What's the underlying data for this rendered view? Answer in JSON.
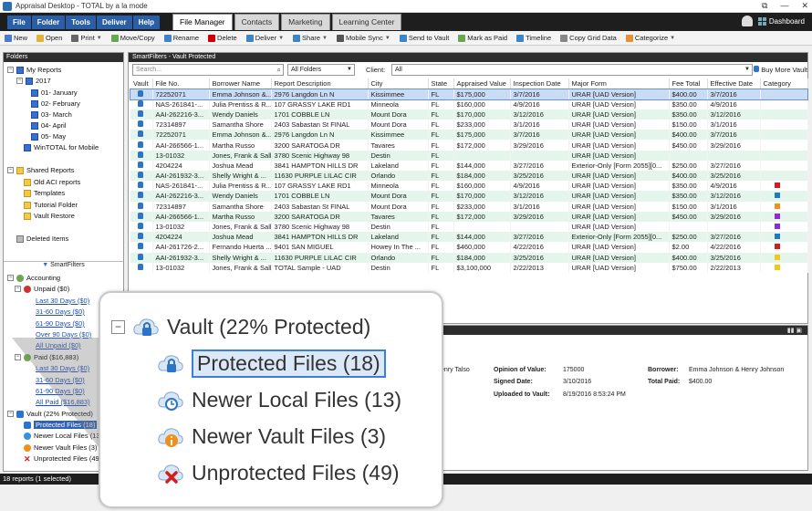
{
  "window": {
    "title": "Appraisal Desktop - TOTAL by a la mode",
    "controls": [
      "⧉",
      "—",
      "✕"
    ]
  },
  "menubar": {
    "menus": [
      "File",
      "Folder",
      "Tools",
      "Deliver",
      "Help"
    ],
    "tabs": [
      "File Manager",
      "Contacts",
      "Marketing",
      "Learning Center"
    ],
    "dashboard_label": "Dashboard"
  },
  "toolbar": {
    "items": [
      {
        "label": "New",
        "icon": "new-icon",
        "color": "#4a7bd0"
      },
      {
        "label": "Open",
        "icon": "open-icon",
        "color": "#e0b43c"
      },
      {
        "label": "Print",
        "icon": "print-icon",
        "color": "#666666",
        "caret": true
      },
      {
        "label": "Move/Copy",
        "icon": "move-copy-icon",
        "color": "#6aa84f"
      },
      {
        "label": "Rename",
        "icon": "rename-icon",
        "color": "#3d85c6"
      },
      {
        "label": "Delete",
        "icon": "delete-icon",
        "color": "#cc0000"
      },
      {
        "label": "Deliver",
        "icon": "deliver-icon",
        "color": "#3d85c6",
        "caret": true
      },
      {
        "label": "Share",
        "icon": "share-icon",
        "color": "#3d85c6",
        "caret": true
      },
      {
        "label": "Mobile Sync",
        "icon": "mobile-sync-icon",
        "color": "#555555",
        "caret": true
      },
      {
        "label": "Send to Vault",
        "icon": "send-vault-icon",
        "color": "#3d85c6"
      },
      {
        "label": "Mark as Paid",
        "icon": "mark-paid-icon",
        "color": "#6aa84f"
      },
      {
        "label": "Timeline",
        "icon": "timeline-icon",
        "color": "#3d85c6"
      },
      {
        "label": "Copy Grid Data",
        "icon": "copy-grid-icon",
        "color": "#888888"
      },
      {
        "label": "Categorize",
        "icon": "categorize-icon",
        "color": "#e69138",
        "caret": true
      }
    ]
  },
  "folders": {
    "header": "Folders",
    "my_reports": "My Reports",
    "year": "2017",
    "months": [
      "01- January",
      "02- February",
      "03- March",
      "04- April",
      "05- May"
    ],
    "wintotal": "WinTOTAL for Mobile",
    "shared_reports": "Shared Reports",
    "shared_items": [
      "Old ACI reports",
      "Templates",
      "Tutorial Folder",
      "Vault Restore"
    ],
    "deleted_items": "Deleted Items",
    "smartfilters_label": "SmartFilters",
    "accounting": "Accounting",
    "unpaid": "Unpaid ($0)",
    "unpaid_items": [
      "Last 30 Days ($0)",
      "31-60 Days ($0)",
      "61-90 Days ($0)",
      "Over 90 Days ($0)",
      "All Unpaid ($0)"
    ],
    "paid": "Paid ($16,883)",
    "paid_items": [
      "Last 30 Days ($0)",
      "31-60 Days ($0)",
      "61-90 Days ($0)",
      "All Paid ($16,883)"
    ],
    "vault": "Vault (22% Protected)",
    "vault_items": [
      "Protected Files (18)",
      "Newer Local Files (13)",
      "Newer Vault Files (3)",
      "Unprotected Files (49)"
    ]
  },
  "main": {
    "header": "SmartFilters - Vault Protected",
    "search_placeholder": "Search...",
    "folder_filter": "All Folders",
    "client_label": "Client:",
    "client_filter": "All",
    "buy_more": "Buy More Vault",
    "columns": [
      "Vault",
      "File No.",
      "Borrower Name",
      "Report Description",
      "City",
      "State",
      "Appraised Value",
      "Inspection Date",
      "Major Form",
      "Fee Total",
      "Effective Date",
      "Category"
    ],
    "rows": [
      [
        "72252071",
        "Emma Johnson &...",
        "2976 Langdon Ln N",
        "Kissimmee",
        "FL",
        "$175,000",
        "3/7/2016",
        "URAR [UAD Version]",
        "$400.00",
        "3/7/2016",
        ""
      ],
      [
        "NAS-261841-...",
        "Julia Prentiss & R...",
        "107 GRASSY LAKE RD1",
        "Minneola",
        "FL",
        "$160,000",
        "4/9/2016",
        "URAR [UAD Version]",
        "$350.00",
        "4/9/2016",
        ""
      ],
      [
        "AAI-262216-3...",
        "Wendy Daniels",
        "1701 COBBLE LN",
        "Mount Dora",
        "FL",
        "$170,000",
        "3/12/2016",
        "URAR [UAD Version]",
        "$350.00",
        "3/12/2016",
        ""
      ],
      [
        "72314897",
        "Samantha Shore",
        "2403 Sabastan St FINAL",
        "Mount Dora",
        "FL",
        "$233,000",
        "3/1/2016",
        "URAR [UAD Version]",
        "$150.00",
        "3/1/2016",
        ""
      ],
      [
        "72252071",
        "Emma Johnson &...",
        "2976 Langdon Ln N",
        "Kissimmee",
        "FL",
        "$175,000",
        "3/7/2016",
        "URAR [UAD Version]",
        "$400.00",
        "3/7/2016",
        ""
      ],
      [
        "AAI-266566-1...",
        "Martha Russo",
        "3200 SARATOGA DR",
        "Tavares",
        "FL",
        "$172,000",
        "3/29/2016",
        "URAR [UAD Version]",
        "$450.00",
        "3/29/2016",
        ""
      ],
      [
        "13-01032",
        "Jones, Frank & Sally",
        "3780 Scenic Highway 98",
        "Destin",
        "FL",
        "",
        "",
        "URAR [UAD Version]",
        "",
        "",
        ""
      ],
      [
        "4204224",
        "Joshua Mead",
        "3841 HAMPTON HILLS DR",
        "Lakeland",
        "FL",
        "$144,000",
        "3/27/2016",
        "Exterior-Only [Form 2055][0...",
        "$250.00",
        "3/27/2016",
        ""
      ],
      [
        "AAI-261932-3...",
        "Shelly Wright & ...",
        "11630 PURPLE LILAC CIR",
        "Orlando",
        "FL",
        "$184,000",
        "3/25/2016",
        "URAR [UAD Version]",
        "$400.00",
        "3/25/2016",
        ""
      ],
      [
        "NAS-261841-...",
        "Julia Prentiss & R...",
        "107 GRASSY LAKE RD1",
        "Minneola",
        "FL",
        "$160,000",
        "4/9/2016",
        "URAR [UAD Version]",
        "$350.00",
        "4/9/2016",
        "red"
      ],
      [
        "AAI-262216-3...",
        "Wendy Daniels",
        "1701 COBBLE LN",
        "Mount Dora",
        "FL",
        "$170,000",
        "3/12/2016",
        "URAR [UAD Version]",
        "$350.00",
        "3/12/2016",
        "blue"
      ],
      [
        "72314897",
        "Samantha Shore",
        "2403 Sabastan St FINAL",
        "Mount Dora",
        "FL",
        "$233,000",
        "3/1/2016",
        "URAR [UAD Version]",
        "$150.00",
        "3/1/2016",
        "orange"
      ],
      [
        "AAI-266566-1...",
        "Martha Russo",
        "3200 SARATOGA DR",
        "Tavares",
        "FL",
        "$172,000",
        "3/29/2016",
        "URAR [UAD Version]",
        "$450.00",
        "3/29/2016",
        "purple"
      ],
      [
        "13-01032",
        "Jones, Frank & Sally",
        "3780 Scenic Highway 98",
        "Destin",
        "FL",
        "",
        "",
        "URAR [UAD Version]",
        "",
        "",
        "purple"
      ],
      [
        "4204224",
        "Joshua Mead",
        "3841 HAMPTON HILLS DR",
        "Lakeland",
        "FL",
        "$144,000",
        "3/27/2016",
        "Exterior-Only [Form 2055][0...",
        "$250.00",
        "3/27/2016",
        "blue"
      ],
      [
        "AAI-261726-2...",
        "Fernando Huerta ...",
        "9401 SAN MIGUEL",
        "Howey In The ...",
        "FL",
        "$460,000",
        "4/22/2016",
        "URAR [UAD Version]",
        "$2.00",
        "4/22/2016",
        "red"
      ],
      [
        "AAI-261932-3...",
        "Shelly Wright & ...",
        "11630 PURPLE LILAC CIR",
        "Orlando",
        "FL",
        "$184,000",
        "3/25/2016",
        "URAR [UAD Version]",
        "$400.00",
        "3/25/2016",
        "yellow"
      ],
      [
        "13-01032",
        "Jones, Frank & Sally",
        "TOTAL Sample - UAD",
        "Destin",
        "FL",
        "$3,100,000",
        "2/22/2013",
        "URAR [UAD Version]",
        "$750.00",
        "2/22/2013",
        "yellow"
      ]
    ],
    "category_colors": {
      "red": "#d41d1d",
      "blue": "#1f78c8",
      "orange": "#f0901a",
      "purple": "#8e2bd6",
      "yellow": "#f5c518"
    }
  },
  "detail": {
    "borrower_fragment": "enry Talso",
    "opinion_label": "Opinion of Value:",
    "opinion_value": "175000",
    "signed_label": "Signed Date:",
    "signed_value": "3/10/2016",
    "uploaded_label": "Uploaded to Vault:",
    "uploaded_value": "8/19/2016 8:53:24 PM",
    "borrower_label": "Borrower:",
    "borrower_value": "Emma Johnson & Henry Johnson",
    "paid_label": "Total Paid:",
    "paid_value": "$400.00"
  },
  "status": {
    "text": "18 reports (1 selected)"
  },
  "zoom": {
    "vault": "Vault (22% Protected)",
    "items": [
      "Protected Files (18)",
      "Newer Local Files (13)",
      "Newer Vault Files (3)",
      "Unprotected Files (49)"
    ]
  }
}
